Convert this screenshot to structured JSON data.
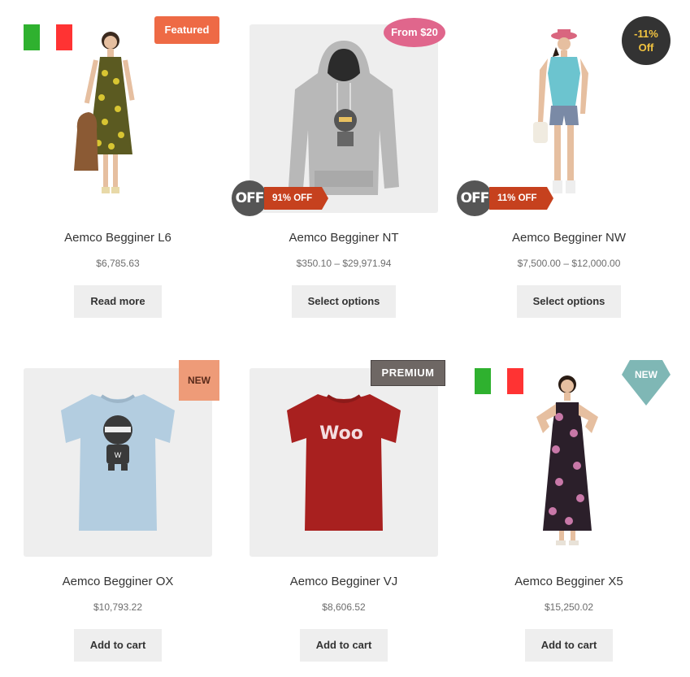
{
  "products": [
    {
      "title": "Aemco Begginer L6",
      "price": "$6,785.63",
      "button": "Read more",
      "badge": "Featured",
      "flag": "italy-flag"
    },
    {
      "title": "Aemco Begginer NT",
      "price": "$350.10 – $29,971.94",
      "button": "Select options",
      "badge": "From $20",
      "off_icon": "OFF",
      "off_ribbon": "91% OFF"
    },
    {
      "title": "Aemco Begginer NW",
      "price": "$7,500.00 – $12,000.00",
      "button": "Select options",
      "badge_line1": "-11%",
      "badge_line2": "Off",
      "off_icon": "OFF",
      "off_ribbon": "11% OFF"
    },
    {
      "title": "Aemco Begginer OX",
      "price": "$10,793.22",
      "button": "Add to cart",
      "badge": "NEW"
    },
    {
      "title": "Aemco Begginer VJ",
      "price": "$8,606.52",
      "button": "Add to cart",
      "badge": "PREMIUM",
      "shirt_text": "Woo"
    },
    {
      "title": "Aemco Begginer X5",
      "price": "$15,250.02",
      "button": "Add to cart",
      "badge": "NEW",
      "flag": "italy-flag"
    }
  ],
  "colors": {
    "featured": "#ee6a45",
    "from": "#e0668c",
    "percent_bg": "#333333",
    "percent_text": "#f2c440",
    "new_square": "#ee9b78",
    "premium": "#6e6764",
    "new_diamond": "#7fb7b5",
    "off_ribbon": "#c6411e",
    "button_bg": "#eeeeee"
  }
}
